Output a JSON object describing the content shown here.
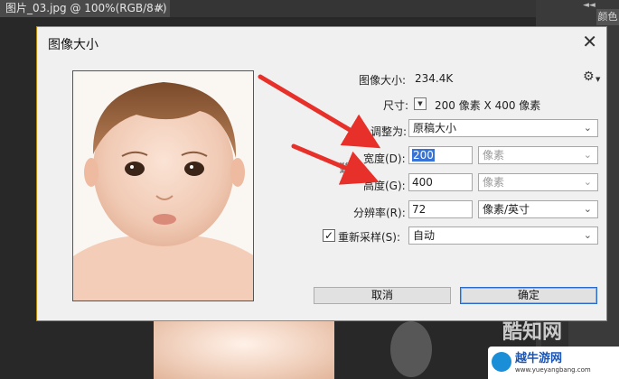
{
  "document_tab": {
    "title": "图片_03.jpg @ 100%(RGB/8#) *",
    "close": "×"
  },
  "right_panel": {
    "collapse_glyph": "◄◄",
    "tab_label": "颜色"
  },
  "dialog": {
    "title": "图像大小",
    "close_glyph": "✕",
    "image_size_label": "图像大小:",
    "image_size_value": "234.4K",
    "dimensions_label": "尺寸:",
    "dimensions_value": "200 像素  X  400 像素",
    "fit_to_label": "调整为:",
    "fit_to_value": "原稿大小",
    "width_label": "宽度(D):",
    "width_value": "200",
    "width_unit": "像素",
    "height_label": "高度(G):",
    "height_value": "400",
    "height_unit": "像素",
    "resolution_label": "分辨率(R):",
    "resolution_value": "72",
    "resolution_unit": "像素/英寸",
    "resample_label": "重新采样(S):",
    "resample_checked": "✓",
    "resample_value": "自动",
    "cancel_label": "取消",
    "ok_label": "确定"
  },
  "watermark": {
    "site_text": "酷知网",
    "badge_title": "越牛游网",
    "badge_url": "www.yueyangbang.com"
  },
  "colors": {
    "arrow": "#e8302a",
    "dialog_border": "#b8860b",
    "primary_border": "#2a6bc9"
  }
}
